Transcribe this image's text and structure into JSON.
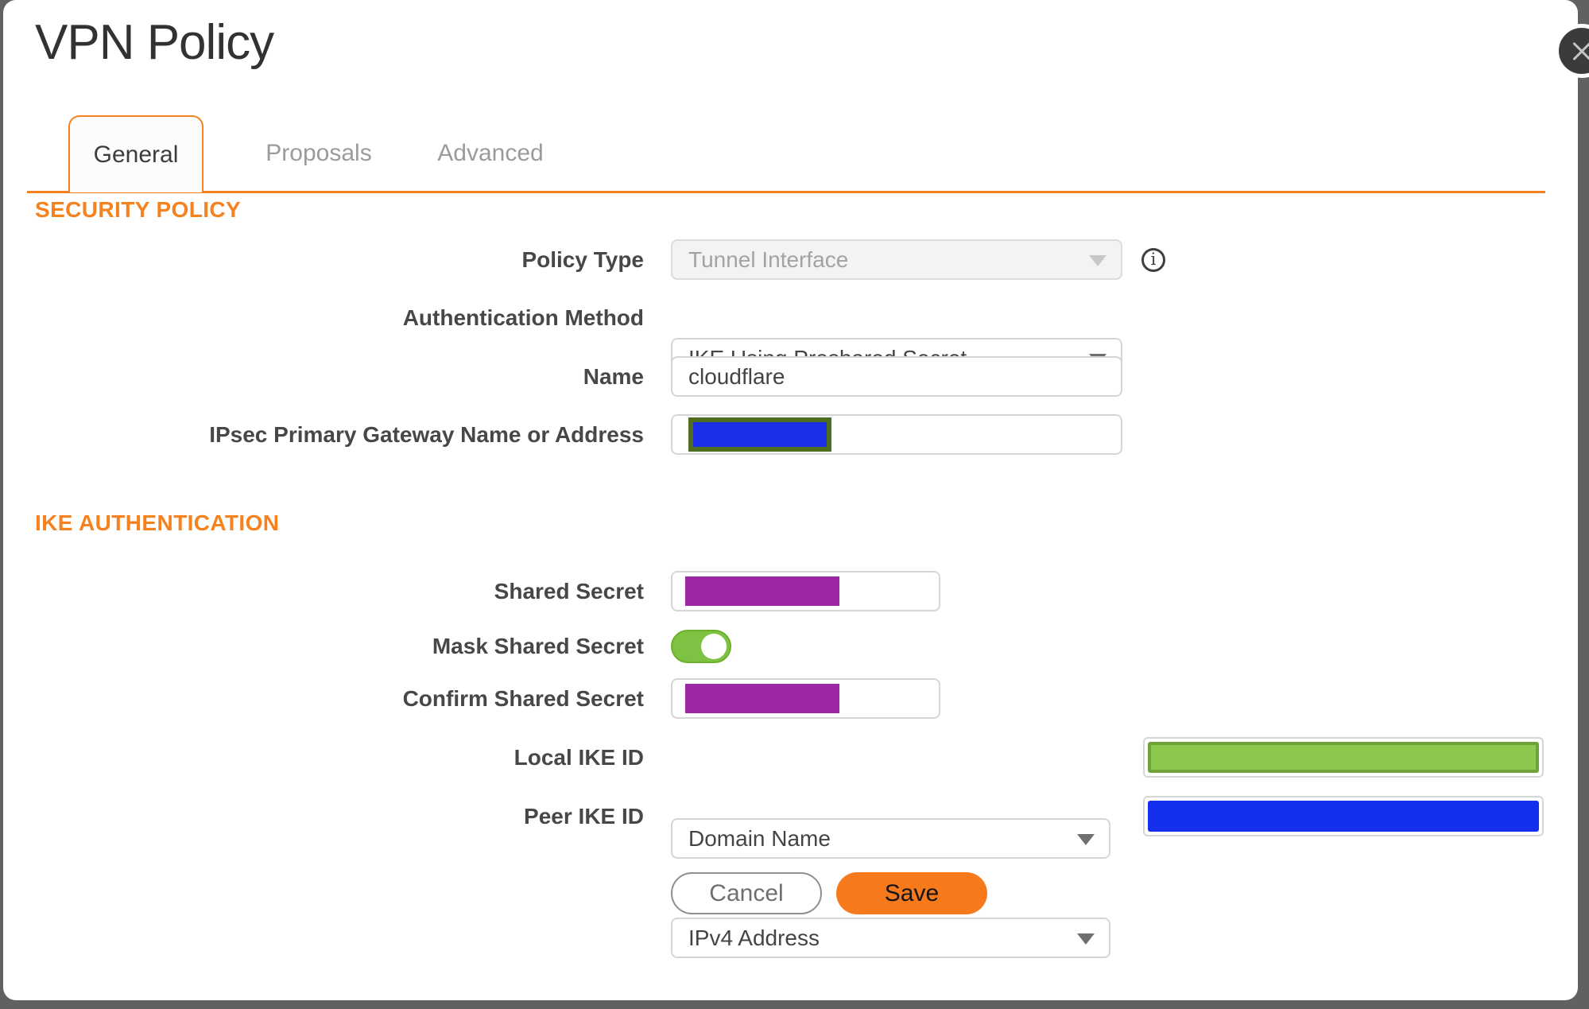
{
  "dialog": {
    "title": "VPN Policy"
  },
  "tabs": [
    {
      "label": "General",
      "active": true
    },
    {
      "label": "Proposals",
      "active": false
    },
    {
      "label": "Advanced",
      "active": false
    }
  ],
  "sections": {
    "security_policy": "SECURITY POLICY",
    "ike_authentication": "IKE AUTHENTICATION"
  },
  "fields": {
    "policy_type": {
      "label": "Policy Type",
      "value": "Tunnel Interface",
      "disabled": true
    },
    "auth_method": {
      "label": "Authentication Method",
      "value": "IKE Using Preshared Secret"
    },
    "name": {
      "label": "Name",
      "value": "cloudflare"
    },
    "gateway": {
      "label": "IPsec Primary Gateway Name or Address",
      "value_redacted": true
    },
    "shared_secret": {
      "label": "Shared Secret",
      "value_redacted": true
    },
    "mask_shared_secret": {
      "label": "Mask Shared Secret",
      "on": true
    },
    "confirm_shared_secret": {
      "label": "Confirm Shared Secret",
      "value_redacted": true
    },
    "local_ike_id": {
      "label": "Local IKE ID",
      "value": "Domain Name",
      "side_value_redacted": true
    },
    "peer_ike_id": {
      "label": "Peer IKE ID",
      "value": "IPv4 Address",
      "side_value_redacted": true
    }
  },
  "buttons": {
    "cancel": "Cancel",
    "save": "Save"
  },
  "colors": {
    "accent_orange": "#F5821F",
    "save_button_orange": "#F67A1C",
    "toggle_green": "#7DC242",
    "redaction_blue": "#1C2FE8",
    "redaction_blue_peer": "#1430EE",
    "redaction_purple": "#9C27A5",
    "redaction_green_fill": "#8CC74E",
    "redaction_green_border": "#6FA339",
    "redaction_olive_border": "#4E6D1F",
    "backdrop_gray": "#616161"
  }
}
